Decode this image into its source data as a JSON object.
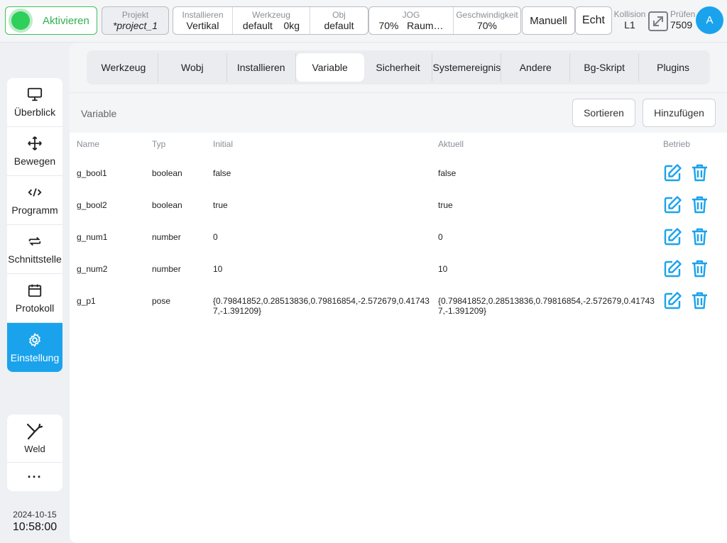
{
  "topbar": {
    "activate": "Aktivieren",
    "project": {
      "caption": "Projekt",
      "value": "*project_1"
    },
    "install": {
      "caption": "Installieren",
      "value": "Vertikal"
    },
    "tool": {
      "caption": "Werkzeug",
      "value1": "default",
      "value2": "0kg"
    },
    "obj": {
      "caption": "Obj",
      "value": "default"
    },
    "jog": {
      "caption": "JOG",
      "value1": "70%",
      "value2": "Raum…"
    },
    "speed": {
      "caption": "Geschwindigkeit",
      "value": "70%"
    },
    "mode": "Manuell",
    "real": "Echt",
    "collision": {
      "caption": "Kollision",
      "value": "L1"
    },
    "check": {
      "caption": "Prüfen",
      "value": "7509"
    },
    "avatar": "A"
  },
  "sidebar": {
    "items": [
      {
        "label": "Überblick",
        "icon": "monitor-icon"
      },
      {
        "label": "Bewegen",
        "icon": "move-icon"
      },
      {
        "label": "Programm",
        "icon": "code-icon"
      },
      {
        "label": "Schnittstelle",
        "icon": "swap-icon"
      },
      {
        "label": "Protokoll",
        "icon": "calendar-icon"
      },
      {
        "label": "Einstellung",
        "icon": "gear-icon",
        "active": true
      }
    ],
    "weld": "Weld",
    "more": "···",
    "date": "2024-10-15",
    "time": "10:58:00"
  },
  "tabs": [
    "Werkzeug",
    "Wobj",
    "Installieren",
    "Variable",
    "Sicherheit",
    "Systemereignis",
    "Andere",
    "Bg-Skript",
    "Plugins"
  ],
  "active_tab": "Variable",
  "subheader": {
    "title": "Variable",
    "sort": "Sortieren",
    "add": "Hinzufügen"
  },
  "table": {
    "headers": {
      "name": "Name",
      "type": "Typ",
      "initial": "Initial",
      "current": "Aktuell",
      "op": "Betrieb"
    },
    "rows": [
      {
        "name": "g_bool1",
        "type": "boolean",
        "initial": "false",
        "current": "false"
      },
      {
        "name": "g_bool2",
        "type": "boolean",
        "initial": "true",
        "current": "true"
      },
      {
        "name": "g_num1",
        "type": "number",
        "initial": "0",
        "current": "0"
      },
      {
        "name": "g_num2",
        "type": "number",
        "initial": "10",
        "current": "10"
      },
      {
        "name": "g_p1",
        "type": "pose",
        "initial": "{0.79841852,0.28513836,0.79816854,-2.572679,0.417437,-1.391209}",
        "current": "{0.79841852,0.28513836,0.79816854,-2.572679,0.417437,-1.391209}"
      }
    ]
  },
  "colors": {
    "accent": "#1aa3ec",
    "active_green": "#2fcf5c"
  }
}
